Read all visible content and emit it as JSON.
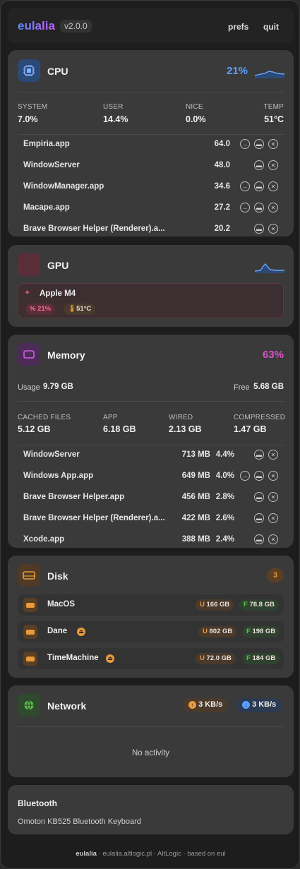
{
  "header": {
    "app_name": "eulalia",
    "version": "v2.0.0",
    "prefs": "prefs",
    "quit": "quit"
  },
  "cpu": {
    "title": "CPU",
    "percent": "21%",
    "stats": [
      {
        "label": "SYSTEM",
        "value": "7.0%"
      },
      {
        "label": "USER",
        "value": "14.4%"
      },
      {
        "label": "NICE",
        "value": "0.0%"
      },
      {
        "label": "TEMP",
        "value": "51°C"
      }
    ],
    "processes": [
      {
        "name": "Empiria.app",
        "value": "64.0",
        "focusable": true
      },
      {
        "name": "WindowServer",
        "value": "48.0",
        "focusable": false
      },
      {
        "name": "WindowManager.app",
        "value": "34.6",
        "focusable": true
      },
      {
        "name": "Macape.app",
        "value": "27.2",
        "focusable": true
      },
      {
        "name": "Brave Browser Helper (Renderer).a...",
        "value": "20.2",
        "focusable": false
      }
    ]
  },
  "gpu": {
    "title": "GPU",
    "device": "Apple M4",
    "usage": "21%",
    "temp": "51°C"
  },
  "memory": {
    "title": "Memory",
    "percent": "63%",
    "usage_label": "Usage",
    "usage_value": "9.79 GB",
    "free_label": "Free",
    "free_value": "5.68 GB",
    "stats": [
      {
        "label": "CACHED FILES",
        "value": "5.12 GB"
      },
      {
        "label": "APP",
        "value": "6.18 GB"
      },
      {
        "label": "WIRED",
        "value": "2.13 GB"
      },
      {
        "label": "COMPRESSED",
        "value": "1.47 GB"
      }
    ],
    "processes": [
      {
        "name": "WindowServer",
        "size": "713 MB",
        "pct": "4.4%",
        "focusable": false
      },
      {
        "name": "Windows App.app",
        "size": "649 MB",
        "pct": "4.0%",
        "focusable": true
      },
      {
        "name": "Brave Browser Helper.app",
        "size": "456 MB",
        "pct": "2.8%",
        "focusable": false
      },
      {
        "name": "Brave Browser Helper (Renderer).a...",
        "size": "422 MB",
        "pct": "2.6%",
        "focusable": false
      },
      {
        "name": "Xcode.app",
        "size": "388 MB",
        "pct": "2.4%",
        "focusable": false
      }
    ]
  },
  "disk": {
    "title": "Disk",
    "count": "3",
    "disks": [
      {
        "name": "MacOS",
        "used": "166 GB",
        "free": "78.8 GB",
        "ejectable": false
      },
      {
        "name": "Dane",
        "used": "802 GB",
        "free": "198 GB",
        "ejectable": true
      },
      {
        "name": "TimeMachine",
        "used": "72.0 GB",
        "free": "184 GB",
        "ejectable": true
      }
    ],
    "used_prefix": "U",
    "free_prefix": "F"
  },
  "network": {
    "title": "Network",
    "upload": "3 KB/s",
    "download": "3 KB/s",
    "empty": "No activity"
  },
  "bluetooth": {
    "title": "Bluetooth",
    "device": "Omoton KB525 Bluetooth Keyboard"
  },
  "footer": {
    "brand": "eulalia",
    "site": "eulalia.altlogic.pl",
    "credit": "AltLogic · based on eul",
    "sep": "·"
  },
  "colors": {
    "cpu_accent": "#5aa0ff",
    "memory_accent": "#e04fd0",
    "disk_accent": "#e89a3c",
    "gpu_accent": "#e0507a",
    "network_accent": "#5bbd4a"
  }
}
